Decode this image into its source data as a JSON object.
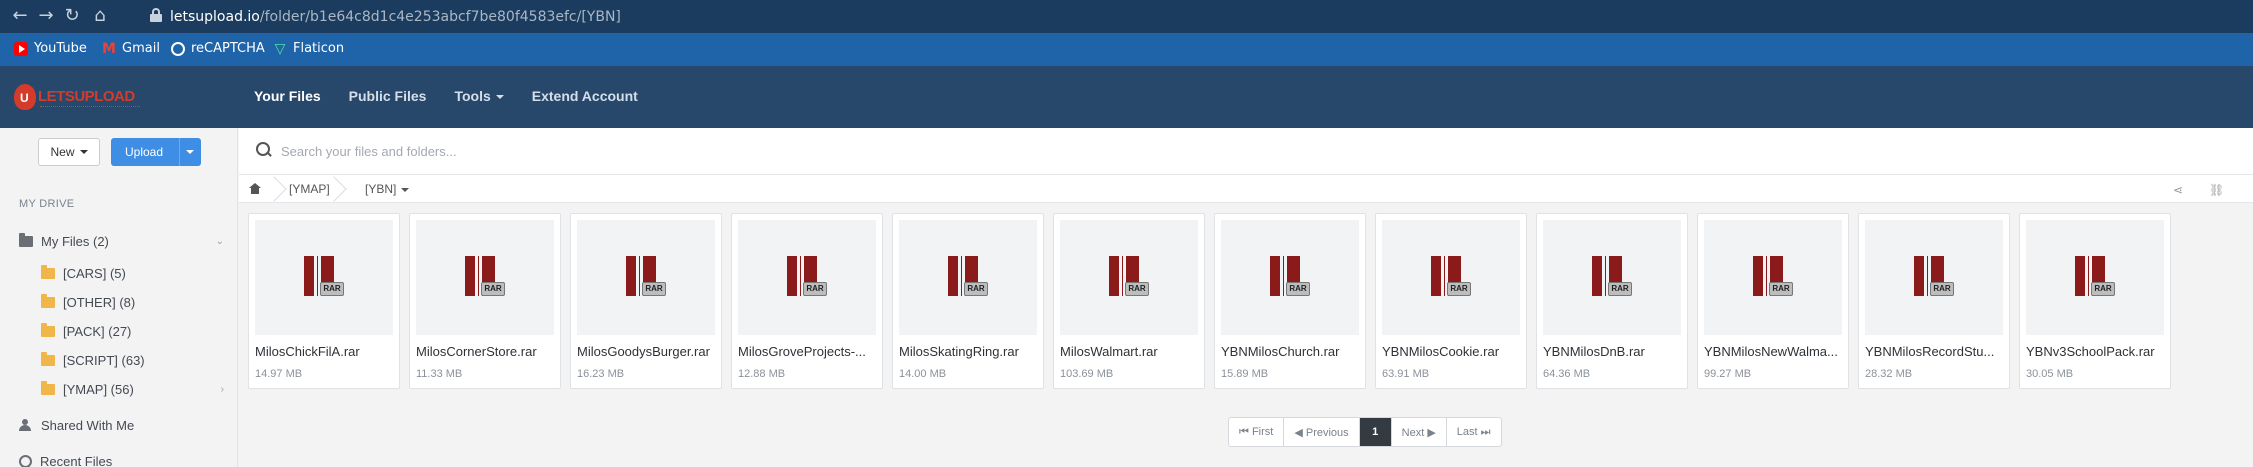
{
  "browser": {
    "back_icon": "arrow-left-icon",
    "forward_icon": "arrow-right-icon",
    "reload_icon": "reload-icon",
    "home_icon": "home-icon",
    "url_host": "letsupload.io",
    "url_path": "/folder/b1e64c8d1c4e253abcf7be80f4583efc/[YBN]",
    "bookmarks": [
      {
        "label": "YouTube",
        "icon": "youtube-icon"
      },
      {
        "label": "Gmail",
        "icon": "gmail-icon"
      },
      {
        "label": "reCAPTCHA",
        "icon": "recaptcha-icon"
      },
      {
        "label": "Flaticon",
        "icon": "flaticon-icon"
      }
    ]
  },
  "header": {
    "logo_text": "LETSUPLOAD",
    "nav": [
      {
        "label": "Your Files"
      },
      {
        "label": "Public Files"
      },
      {
        "label": "Tools"
      },
      {
        "label": "Extend Account"
      }
    ]
  },
  "sidebar": {
    "new_label": "New",
    "upload_label": "Upload",
    "section_label": "MY DRIVE",
    "my_files": "My Files (2)",
    "folders": [
      {
        "label": "[CARS] (5)"
      },
      {
        "label": "[OTHER] (8)"
      },
      {
        "label": "[PACK] (27)"
      },
      {
        "label": "[SCRIPT] (63)"
      },
      {
        "label": "[YMAP] (56)"
      }
    ],
    "shared": "Shared With Me",
    "recent": "Recent Files"
  },
  "search": {
    "placeholder": "Search your files and folders..."
  },
  "breadcrumb": {
    "items": [
      "[YMAP]",
      "[YBN]"
    ]
  },
  "files": [
    {
      "name": "MilosChickFilA.rar",
      "size": "14.97 MB"
    },
    {
      "name": "MilosCornerStore.rar",
      "size": "11.33 MB"
    },
    {
      "name": "MilosGoodysBurger.rar",
      "size": "16.23 MB"
    },
    {
      "name": "MilosGroveProjects-...",
      "size": "12.88 MB"
    },
    {
      "name": "MilosSkatingRing.rar",
      "size": "14.00 MB"
    },
    {
      "name": "MilosWalmart.rar",
      "size": "103.69 MB"
    },
    {
      "name": "YBNMilosChurch.rar",
      "size": "15.89 MB"
    },
    {
      "name": "YBNMilosCookie.rar",
      "size": "63.91 MB"
    },
    {
      "name": "YBNMilosDnB.rar",
      "size": "64.36 MB"
    },
    {
      "name": "YBNMilosNewWalma...",
      "size": "99.27 MB"
    },
    {
      "name": "YBNMilosRecordStu...",
      "size": "28.32 MB"
    },
    {
      "name": "YBNv3SchoolPack.rar",
      "size": "30.05 MB"
    }
  ],
  "pagination": {
    "first": "⏮ First",
    "previous": "◀ Previous",
    "current": "1",
    "next": "Next ▶",
    "last": "Last ⏭"
  },
  "colors": {
    "chrome": "#1b3c5e",
    "bookmarks_bar": "#1f63a8",
    "app_header": "#27476b",
    "upload_button": "#3d8ee4",
    "rar_icon": "#8b1a1a"
  }
}
